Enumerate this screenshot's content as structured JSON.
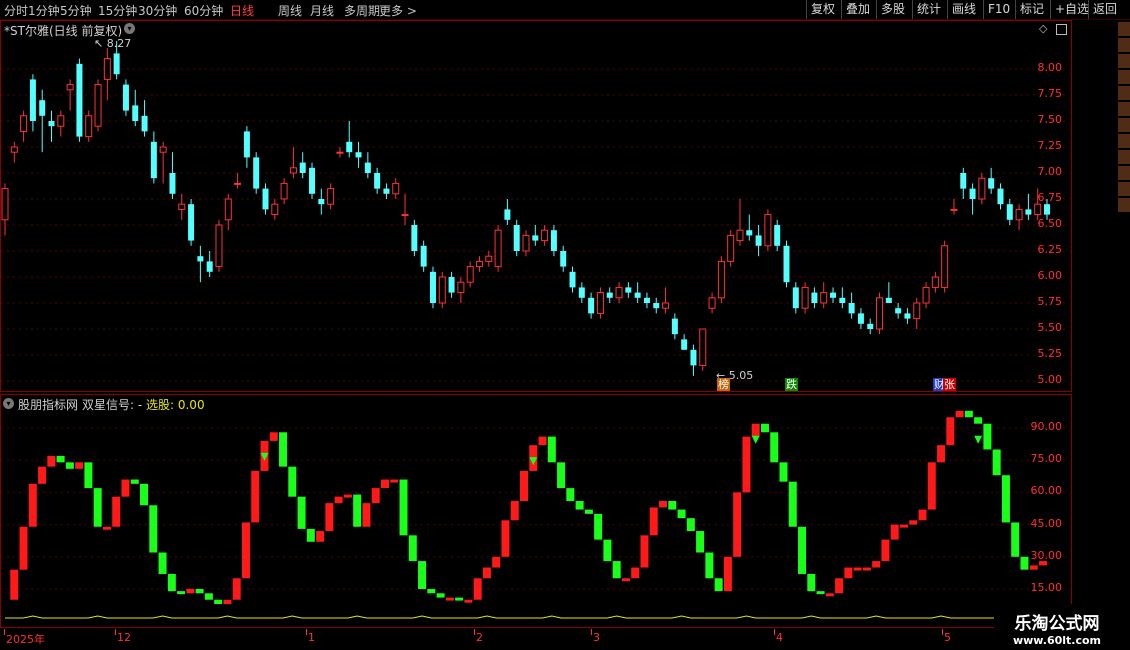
{
  "toolbar": {
    "periods": [
      "分时",
      "1分钟",
      "5分钟",
      "15分钟",
      "30分钟",
      "60分钟",
      "日线",
      "周线",
      "月线",
      "多周期",
      "更多 >"
    ],
    "active_period": "日线",
    "right_buttons": [
      "复权",
      "叠加",
      "多股",
      "统计",
      "画线",
      "F10",
      "标记",
      "+自选",
      "返回"
    ]
  },
  "main": {
    "title": "*ST尔雅(日线 前复权)",
    "high_label": "8.27",
    "low_label": "5.05",
    "y_ticks": [
      "8.00",
      "7.75",
      "7.50",
      "7.25",
      "7.00",
      "6.75",
      "6.50",
      "6.25",
      "6.00",
      "5.75",
      "5.50",
      "5.25",
      "5.00"
    ],
    "markers": [
      {
        "text": "榜",
        "color": "#c86400"
      },
      {
        "text": "跌",
        "color": "#0a8a00"
      },
      {
        "text": "财",
        "color": "#1e3cc8"
      },
      {
        "text": "张",
        "color": "#c80000"
      }
    ]
  },
  "sub": {
    "indicator_name": "股朋指标网",
    "signal_label": "双星信号: -",
    "select_label": "选股: 0.00",
    "y_ticks": [
      "90.00",
      "75.00",
      "60.00",
      "45.00",
      "30.00",
      "15.00"
    ]
  },
  "time_axis": [
    "2025年",
    "12",
    "1",
    "2",
    "3",
    "4",
    "5"
  ],
  "watermark": {
    "title": "乐淘公式网",
    "url": "www.60lt.com"
  },
  "colors": {
    "up": "#ff3333",
    "down": "#54ffff",
    "osc_up": "#ff1a1a",
    "osc_down": "#1aff1a",
    "grid": "#8a0000"
  },
  "chart_data": [
    {
      "type": "candlestick",
      "title": "*ST尔雅(日线 前复权)",
      "ylim": [
        4.9,
        8.4
      ],
      "candles": [
        [
          6.55,
          6.9,
          6.4,
          6.85
        ],
        [
          7.2,
          7.3,
          7.1,
          7.25
        ],
        [
          7.4,
          7.6,
          7.3,
          7.55
        ],
        [
          7.9,
          7.95,
          7.4,
          7.5
        ],
        [
          7.7,
          7.8,
          7.2,
          7.55
        ],
        [
          7.5,
          7.6,
          7.3,
          7.45
        ],
        [
          7.45,
          7.6,
          7.35,
          7.55
        ],
        [
          7.8,
          7.9,
          7.6,
          7.85
        ],
        [
          8.05,
          8.1,
          7.3,
          7.35
        ],
        [
          7.35,
          7.6,
          7.3,
          7.55
        ],
        [
          7.45,
          7.9,
          7.4,
          7.85
        ],
        [
          7.9,
          8.2,
          7.7,
          8.1
        ],
        [
          8.15,
          8.27,
          7.9,
          7.95
        ],
        [
          7.85,
          7.9,
          7.55,
          7.6
        ],
        [
          7.65,
          7.8,
          7.45,
          7.5
        ],
        [
          7.55,
          7.7,
          7.35,
          7.4
        ],
        [
          7.3,
          7.4,
          6.9,
          6.95
        ],
        [
          7.2,
          7.3,
          6.9,
          7.25
        ],
        [
          7.0,
          7.2,
          6.75,
          6.8
        ],
        [
          6.65,
          6.8,
          6.55,
          6.7
        ],
        [
          6.7,
          6.75,
          6.3,
          6.35
        ],
        [
          6.2,
          6.3,
          5.95,
          6.15
        ],
        [
          6.15,
          6.25,
          6.0,
          6.05
        ],
        [
          6.1,
          6.55,
          6.05,
          6.5
        ],
        [
          6.55,
          6.8,
          6.45,
          6.75
        ],
        [
          6.9,
          7.0,
          6.85,
          6.9
        ],
        [
          7.4,
          7.45,
          7.05,
          7.15
        ],
        [
          7.15,
          7.2,
          6.8,
          6.85
        ],
        [
          6.85,
          6.9,
          6.6,
          6.65
        ],
        [
          6.6,
          6.75,
          6.55,
          6.7
        ],
        [
          6.75,
          6.95,
          6.7,
          6.9
        ],
        [
          7.0,
          7.25,
          6.95,
          7.05
        ],
        [
          7.1,
          7.2,
          6.95,
          7.0
        ],
        [
          7.05,
          7.1,
          6.75,
          6.8
        ],
        [
          6.75,
          6.85,
          6.6,
          6.7
        ],
        [
          6.7,
          6.9,
          6.65,
          6.85
        ],
        [
          7.2,
          7.25,
          7.15,
          7.2
        ],
        [
          7.3,
          7.5,
          7.15,
          7.2
        ],
        [
          7.2,
          7.3,
          7.05,
          7.15
        ],
        [
          7.1,
          7.2,
          6.95,
          7.0
        ],
        [
          7.0,
          7.05,
          6.8,
          6.85
        ],
        [
          6.85,
          6.9,
          6.75,
          6.8
        ],
        [
          6.8,
          6.95,
          6.75,
          6.9
        ],
        [
          6.6,
          6.8,
          6.5,
          6.6
        ],
        [
          6.5,
          6.55,
          6.2,
          6.25
        ],
        [
          6.3,
          6.35,
          6.05,
          6.1
        ],
        [
          6.05,
          6.1,
          5.7,
          5.75
        ],
        [
          5.75,
          6.05,
          5.7,
          6.0
        ],
        [
          6.0,
          6.05,
          5.8,
          5.85
        ],
        [
          5.85,
          6.0,
          5.75,
          5.95
        ],
        [
          5.95,
          6.15,
          5.9,
          6.1
        ],
        [
          6.1,
          6.2,
          6.05,
          6.15
        ],
        [
          6.15,
          6.25,
          6.1,
          6.2
        ],
        [
          6.1,
          6.5,
          6.05,
          6.45
        ],
        [
          6.65,
          6.75,
          6.5,
          6.55
        ],
        [
          6.5,
          6.55,
          6.2,
          6.25
        ],
        [
          6.25,
          6.45,
          6.2,
          6.4
        ],
        [
          6.4,
          6.5,
          6.3,
          6.35
        ],
        [
          6.35,
          6.5,
          6.3,
          6.45
        ],
        [
          6.45,
          6.5,
          6.2,
          6.25
        ],
        [
          6.25,
          6.3,
          6.05,
          6.1
        ],
        [
          6.05,
          6.1,
          5.85,
          5.9
        ],
        [
          5.9,
          5.95,
          5.75,
          5.8
        ],
        [
          5.8,
          5.85,
          5.6,
          5.65
        ],
        [
          5.65,
          5.9,
          5.6,
          5.85
        ],
        [
          5.85,
          5.9,
          5.75,
          5.8
        ],
        [
          5.8,
          5.95,
          5.75,
          5.9
        ],
        [
          5.9,
          5.95,
          5.8,
          5.85
        ],
        [
          5.85,
          5.95,
          5.75,
          5.8
        ],
        [
          5.8,
          5.85,
          5.7,
          5.75
        ],
        [
          5.75,
          5.8,
          5.65,
          5.7
        ],
        [
          5.7,
          5.9,
          5.65,
          5.75
        ],
        [
          5.6,
          5.65,
          5.4,
          5.45
        ],
        [
          5.4,
          5.45,
          5.3,
          5.3
        ],
        [
          5.3,
          5.35,
          5.05,
          5.15
        ],
        [
          5.15,
          5.5,
          5.1,
          5.5
        ],
        [
          5.7,
          5.85,
          5.65,
          5.8
        ],
        [
          5.8,
          6.2,
          5.75,
          6.15
        ],
        [
          6.15,
          6.45,
          6.1,
          6.4
        ],
        [
          6.35,
          6.75,
          6.3,
          6.45
        ],
        [
          6.45,
          6.6,
          6.35,
          6.4
        ],
        [
          6.4,
          6.5,
          6.2,
          6.3
        ],
        [
          6.3,
          6.65,
          6.25,
          6.6
        ],
        [
          6.5,
          6.55,
          6.25,
          6.3
        ],
        [
          6.3,
          6.35,
          5.9,
          5.95
        ],
        [
          5.9,
          5.95,
          5.65,
          5.7
        ],
        [
          5.7,
          5.95,
          5.65,
          5.9
        ],
        [
          5.85,
          5.9,
          5.7,
          5.75
        ],
        [
          5.75,
          5.95,
          5.7,
          5.85
        ],
        [
          5.85,
          5.9,
          5.75,
          5.8
        ],
        [
          5.8,
          5.9,
          5.7,
          5.75
        ],
        [
          5.75,
          5.85,
          5.6,
          5.65
        ],
        [
          5.65,
          5.7,
          5.5,
          5.55
        ],
        [
          5.55,
          5.6,
          5.45,
          5.5
        ],
        [
          5.5,
          5.85,
          5.45,
          5.8
        ],
        [
          5.8,
          5.95,
          5.75,
          5.75
        ],
        [
          5.7,
          5.75,
          5.6,
          5.65
        ],
        [
          5.65,
          5.7,
          5.55,
          5.6
        ],
        [
          5.6,
          5.8,
          5.5,
          5.75
        ],
        [
          5.75,
          5.95,
          5.7,
          5.9
        ],
        [
          5.9,
          6.05,
          5.85,
          6.0
        ],
        [
          5.9,
          6.35,
          5.85,
          6.3
        ],
        [
          6.65,
          6.75,
          6.6,
          6.65
        ],
        [
          7.0,
          7.05,
          6.75,
          6.85
        ],
        [
          6.85,
          6.9,
          6.6,
          6.75
        ],
        [
          6.75,
          7.0,
          6.7,
          6.95
        ],
        [
          6.95,
          7.05,
          6.8,
          6.85
        ],
        [
          6.85,
          6.9,
          6.65,
          6.7
        ],
        [
          6.7,
          6.75,
          6.5,
          6.55
        ],
        [
          6.55,
          6.7,
          6.45,
          6.65
        ],
        [
          6.65,
          6.8,
          6.55,
          6.6
        ],
        [
          6.6,
          6.85,
          6.55,
          6.7
        ],
        [
          6.7,
          6.75,
          6.55,
          6.6
        ]
      ]
    },
    {
      "type": "bar",
      "title": "双星信号",
      "ylim": [
        5,
        100
      ],
      "values": [
        10,
        24,
        44,
        64,
        72,
        77,
        74,
        71,
        74,
        62,
        44,
        44,
        58,
        66,
        64,
        54,
        32,
        22,
        14,
        13,
        15,
        13,
        10,
        8,
        10,
        20,
        46,
        70,
        84,
        88,
        72,
        58,
        43,
        37,
        42,
        55,
        58,
        59,
        44,
        55,
        62,
        66,
        66,
        40,
        28,
        15,
        13,
        11,
        11,
        10,
        10,
        20,
        25,
        30,
        47,
        56,
        70,
        82,
        86,
        74,
        62,
        56,
        52,
        50,
        38,
        28,
        20,
        20,
        25,
        40,
        53,
        56,
        52,
        48,
        42,
        32,
        20,
        14,
        30,
        60,
        86,
        92,
        88,
        74,
        65,
        44,
        22,
        14,
        13,
        13,
        20,
        25,
        25,
        25,
        28,
        38,
        45,
        45,
        47,
        52,
        74,
        82,
        95,
        98,
        95,
        92,
        80,
        68,
        46,
        30,
        24,
        26,
        28
      ]
    }
  ]
}
